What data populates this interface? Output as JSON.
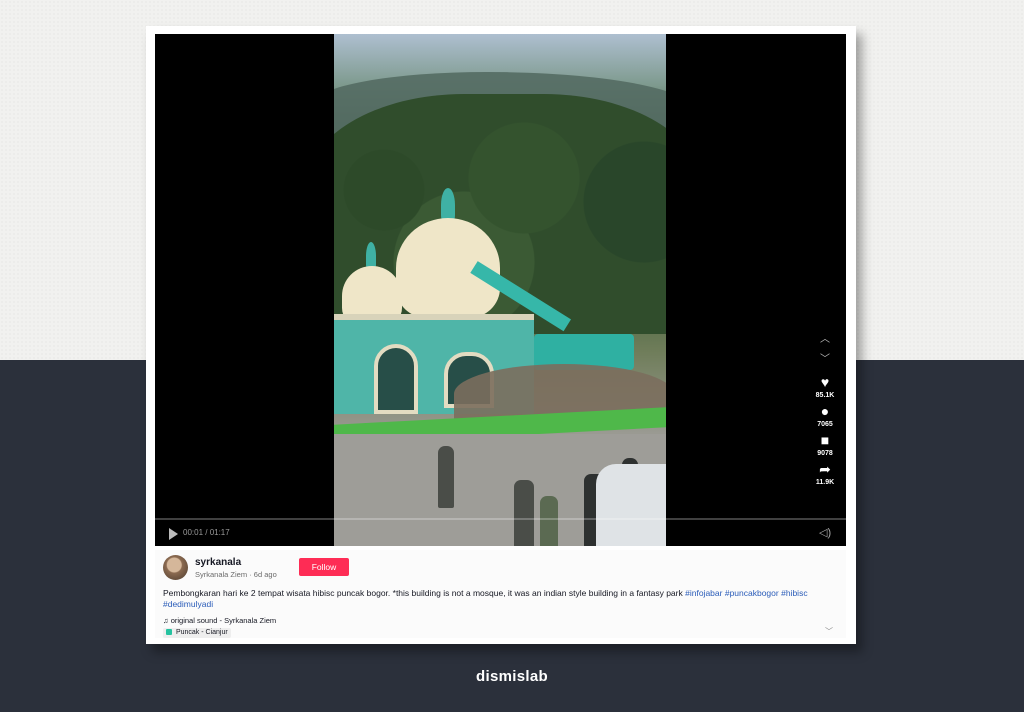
{
  "video": {
    "time": "00:01 / 01:17",
    "actions": [
      {
        "icon": "heart-icon",
        "glyph": "♥",
        "count": "85.1K"
      },
      {
        "icon": "comment-icon",
        "glyph": "●",
        "count": "7065"
      },
      {
        "icon": "bookmark-icon",
        "glyph": "■",
        "count": "9078"
      },
      {
        "icon": "share-icon",
        "glyph": "➦",
        "count": "11.9K"
      }
    ]
  },
  "post": {
    "username": "syrkanala",
    "display_name": "Syrkanala Ziem",
    "age": "6d ago",
    "follow_label": "Follow",
    "caption_text": "Pembongkaran hari ke 2 tempat wisata hibisc puncak bogor. *this building is not a mosque, it was an indian style building in a fantasy park",
    "hashtags": [
      "#infojabar",
      "#puncakbogor",
      "#hibisc",
      "#dedimulyadi"
    ],
    "sound": "original sound - Syrkanala Ziem",
    "location": "Puncak - Cianjur"
  },
  "brand": "dismislab",
  "colors": {
    "follow": "#fe2c55",
    "hashtag": "#2b5db9",
    "background_dark": "#2b303b"
  }
}
